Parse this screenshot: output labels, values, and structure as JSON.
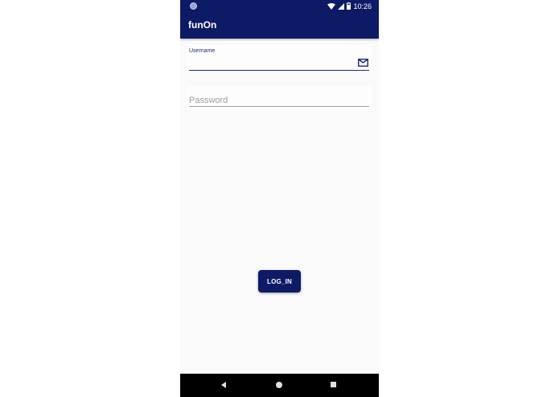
{
  "status_bar": {
    "time": "10:26",
    "icons": [
      "wifi-icon",
      "signal-icon",
      "battery-icon"
    ]
  },
  "app_bar": {
    "title": "funOn"
  },
  "form": {
    "username": {
      "label": "Username",
      "value": "",
      "icon": "mail-icon"
    },
    "password": {
      "placeholder": "Password",
      "value": ""
    }
  },
  "login_button": {
    "label": "LOG_IN"
  },
  "nav_bar": {
    "buttons": [
      "back-icon",
      "home-icon",
      "recents-icon"
    ]
  },
  "colors": {
    "primary": "#0d1b66",
    "background": "#fafafa",
    "accent": "#1c2a78"
  }
}
